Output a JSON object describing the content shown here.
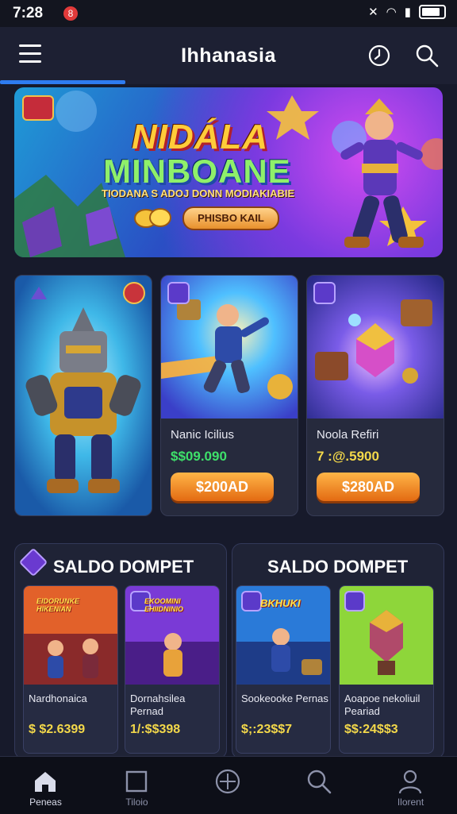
{
  "status_bar": {
    "time": "7:28",
    "notification_badge": "8"
  },
  "header": {
    "title": "Ihhanasia"
  },
  "hero": {
    "title_line1": "NIDÁLA",
    "title_line2": "MINBOANE",
    "subtitle": "TIODANA S ADOJ DONN MODIAKIABIE",
    "button_label": "PHISBO KAIL"
  },
  "cards": [
    {
      "name": "",
      "price": "",
      "button": ""
    },
    {
      "name": "Nanic Icilius",
      "price": "$$09.090",
      "price_color": "#3ee06a",
      "button": "$200AD"
    },
    {
      "name": "Noola Refiri",
      "price": "7 :@.5900",
      "price_color": "#f3d84a",
      "button": "$280AD"
    }
  ],
  "wallet_panels": [
    {
      "title": "SALDO DOMPET",
      "items": [
        {
          "banner": "EIDORUNKE HIKENIAN",
          "name": "Nardhonaica",
          "price": "$ $2.6399"
        },
        {
          "banner": "EKOOMINI EHIIDNINIO",
          "name": "Dornahsilea Pernad",
          "price": "1/:$$398"
        }
      ]
    },
    {
      "title": "SALDO DOMPET",
      "items": [
        {
          "banner": "BKHUKI",
          "name": "Sookeooke Pernas",
          "price": "$;:23$$7"
        },
        {
          "banner": "",
          "name": "Aoapoe nekoliuil Peariad",
          "price": "$$:24$$3"
        }
      ]
    }
  ],
  "bottom_nav": [
    {
      "label": "Peneas",
      "icon": "home-icon"
    },
    {
      "label": "Tiloio",
      "icon": "square-icon"
    },
    {
      "label": "",
      "icon": "crosshair-icon"
    },
    {
      "label": "",
      "icon": "search-icon"
    },
    {
      "label": "Ilorent",
      "icon": "profile-icon"
    }
  ]
}
